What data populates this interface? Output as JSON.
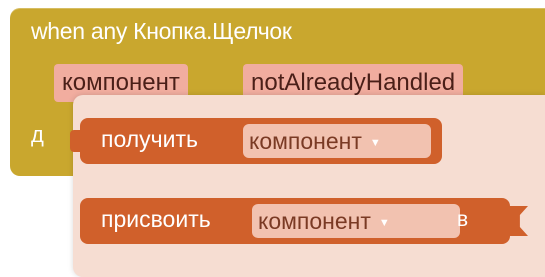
{
  "event": {
    "title": "when any Кнопка.Щелчок",
    "params": [
      "компонент",
      "notAlreadyHandled"
    ],
    "do_label": "д",
    "color": "#c9a72e"
  },
  "popup": {
    "get_block": {
      "label": "получить",
      "dropdown_value": "компонент",
      "dropdown_icon": "dropdown-arrow"
    },
    "set_block": {
      "label": "присвоить",
      "dropdown_value": "компонент",
      "dropdown_icon": "dropdown-arrow",
      "to_label": "в"
    },
    "block_color": "#d0602b",
    "background_color": "#f6ddd2"
  }
}
